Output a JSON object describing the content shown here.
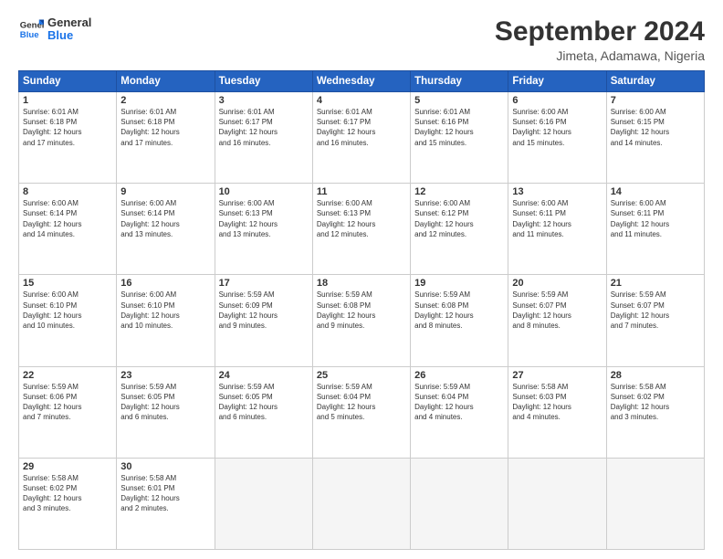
{
  "header": {
    "logo_line1": "General",
    "logo_line2": "Blue",
    "month": "September 2024",
    "location": "Jimeta, Adamawa, Nigeria"
  },
  "columns": [
    "Sunday",
    "Monday",
    "Tuesday",
    "Wednesday",
    "Thursday",
    "Friday",
    "Saturday"
  ],
  "weeks": [
    [
      {
        "day": "1",
        "info": "Sunrise: 6:01 AM\nSunset: 6:18 PM\nDaylight: 12 hours\nand 17 minutes."
      },
      {
        "day": "2",
        "info": "Sunrise: 6:01 AM\nSunset: 6:18 PM\nDaylight: 12 hours\nand 17 minutes."
      },
      {
        "day": "3",
        "info": "Sunrise: 6:01 AM\nSunset: 6:17 PM\nDaylight: 12 hours\nand 16 minutes."
      },
      {
        "day": "4",
        "info": "Sunrise: 6:01 AM\nSunset: 6:17 PM\nDaylight: 12 hours\nand 16 minutes."
      },
      {
        "day": "5",
        "info": "Sunrise: 6:01 AM\nSunset: 6:16 PM\nDaylight: 12 hours\nand 15 minutes."
      },
      {
        "day": "6",
        "info": "Sunrise: 6:00 AM\nSunset: 6:16 PM\nDaylight: 12 hours\nand 15 minutes."
      },
      {
        "day": "7",
        "info": "Sunrise: 6:00 AM\nSunset: 6:15 PM\nDaylight: 12 hours\nand 14 minutes."
      }
    ],
    [
      {
        "day": "8",
        "info": "Sunrise: 6:00 AM\nSunset: 6:14 PM\nDaylight: 12 hours\nand 14 minutes."
      },
      {
        "day": "9",
        "info": "Sunrise: 6:00 AM\nSunset: 6:14 PM\nDaylight: 12 hours\nand 13 minutes."
      },
      {
        "day": "10",
        "info": "Sunrise: 6:00 AM\nSunset: 6:13 PM\nDaylight: 12 hours\nand 13 minutes."
      },
      {
        "day": "11",
        "info": "Sunrise: 6:00 AM\nSunset: 6:13 PM\nDaylight: 12 hours\nand 12 minutes."
      },
      {
        "day": "12",
        "info": "Sunrise: 6:00 AM\nSunset: 6:12 PM\nDaylight: 12 hours\nand 12 minutes."
      },
      {
        "day": "13",
        "info": "Sunrise: 6:00 AM\nSunset: 6:11 PM\nDaylight: 12 hours\nand 11 minutes."
      },
      {
        "day": "14",
        "info": "Sunrise: 6:00 AM\nSunset: 6:11 PM\nDaylight: 12 hours\nand 11 minutes."
      }
    ],
    [
      {
        "day": "15",
        "info": "Sunrise: 6:00 AM\nSunset: 6:10 PM\nDaylight: 12 hours\nand 10 minutes."
      },
      {
        "day": "16",
        "info": "Sunrise: 6:00 AM\nSunset: 6:10 PM\nDaylight: 12 hours\nand 10 minutes."
      },
      {
        "day": "17",
        "info": "Sunrise: 5:59 AM\nSunset: 6:09 PM\nDaylight: 12 hours\nand 9 minutes."
      },
      {
        "day": "18",
        "info": "Sunrise: 5:59 AM\nSunset: 6:08 PM\nDaylight: 12 hours\nand 9 minutes."
      },
      {
        "day": "19",
        "info": "Sunrise: 5:59 AM\nSunset: 6:08 PM\nDaylight: 12 hours\nand 8 minutes."
      },
      {
        "day": "20",
        "info": "Sunrise: 5:59 AM\nSunset: 6:07 PM\nDaylight: 12 hours\nand 8 minutes."
      },
      {
        "day": "21",
        "info": "Sunrise: 5:59 AM\nSunset: 6:07 PM\nDaylight: 12 hours\nand 7 minutes."
      }
    ],
    [
      {
        "day": "22",
        "info": "Sunrise: 5:59 AM\nSunset: 6:06 PM\nDaylight: 12 hours\nand 7 minutes."
      },
      {
        "day": "23",
        "info": "Sunrise: 5:59 AM\nSunset: 6:05 PM\nDaylight: 12 hours\nand 6 minutes."
      },
      {
        "day": "24",
        "info": "Sunrise: 5:59 AM\nSunset: 6:05 PM\nDaylight: 12 hours\nand 6 minutes."
      },
      {
        "day": "25",
        "info": "Sunrise: 5:59 AM\nSunset: 6:04 PM\nDaylight: 12 hours\nand 5 minutes."
      },
      {
        "day": "26",
        "info": "Sunrise: 5:59 AM\nSunset: 6:04 PM\nDaylight: 12 hours\nand 4 minutes."
      },
      {
        "day": "27",
        "info": "Sunrise: 5:58 AM\nSunset: 6:03 PM\nDaylight: 12 hours\nand 4 minutes."
      },
      {
        "day": "28",
        "info": "Sunrise: 5:58 AM\nSunset: 6:02 PM\nDaylight: 12 hours\nand 3 minutes."
      }
    ],
    [
      {
        "day": "29",
        "info": "Sunrise: 5:58 AM\nSunset: 6:02 PM\nDaylight: 12 hours\nand 3 minutes."
      },
      {
        "day": "30",
        "info": "Sunrise: 5:58 AM\nSunset: 6:01 PM\nDaylight: 12 hours\nand 2 minutes."
      },
      {
        "day": "",
        "info": ""
      },
      {
        "day": "",
        "info": ""
      },
      {
        "day": "",
        "info": ""
      },
      {
        "day": "",
        "info": ""
      },
      {
        "day": "",
        "info": ""
      }
    ]
  ]
}
